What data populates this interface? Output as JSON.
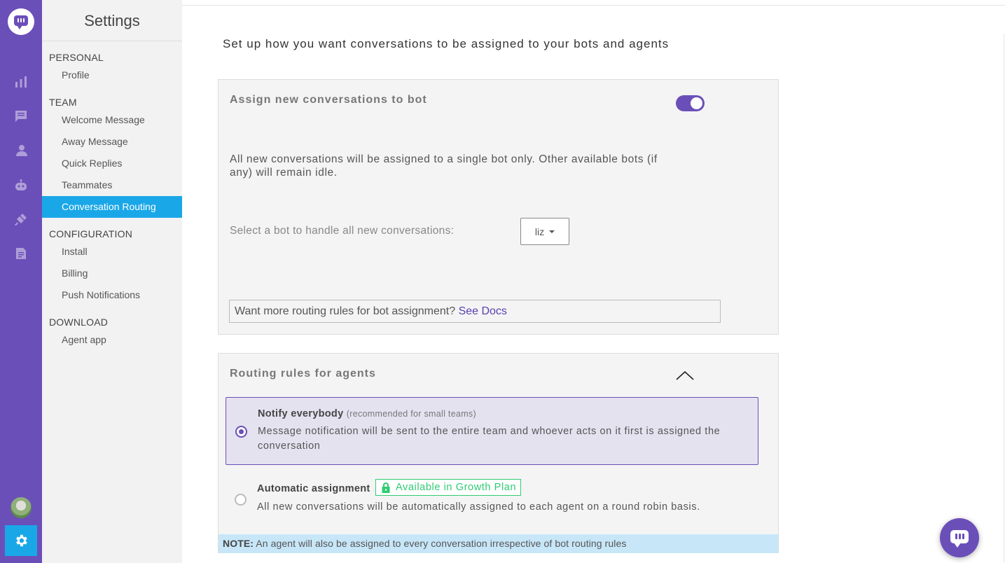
{
  "app": {
    "accent": "#6b4fb8",
    "highlight": "#1aa7e8"
  },
  "rail": {
    "icons": [
      "logo-icon",
      "analytics-icon",
      "conversations-icon",
      "users-icon",
      "bot-icon",
      "integrations-icon",
      "reports-icon",
      "avatar",
      "settings-gear-icon"
    ]
  },
  "sidebar": {
    "title": "Settings",
    "sections": [
      {
        "label": "PERSONAL",
        "items": [
          "Profile"
        ]
      },
      {
        "label": "TEAM",
        "items": [
          "Welcome Message",
          "Away Message",
          "Quick Replies",
          "Teammates",
          "Conversation Routing"
        ]
      },
      {
        "label": "CONFIGURATION",
        "items": [
          "Install",
          "Billing",
          "Push Notifications"
        ]
      },
      {
        "label": "DOWNLOAD",
        "items": [
          "Agent app"
        ]
      }
    ],
    "active_item": "Conversation Routing"
  },
  "main": {
    "heading": "Set up how you want conversations to be assigned to your bots and agents",
    "bot_card": {
      "title": "Assign new conversations to bot",
      "toggle_on": true,
      "description": "All new conversations will be assigned to a single bot only. Other available bots (if any) will remain idle.",
      "select_label": "Select a bot to handle all new conversations:",
      "selected_bot": "liz",
      "docs_text": "Want more routing rules for bot assignment?",
      "docs_link": "See Docs"
    },
    "agent_card": {
      "title": "Routing rules for agents",
      "options": [
        {
          "title": "Notify everybody",
          "subtitle": "(recommended for small teams)",
          "description": "Message notification will be sent to the entire team and whoever acts on it first is assigned the conversation",
          "selected": true
        },
        {
          "title": "Automatic assignment",
          "badge": "Available in Growth Plan",
          "description": "All new conversations will be automatically assigned to each agent on a round robin basis.",
          "selected": false
        }
      ],
      "note_label": "NOTE:",
      "note_text": "An agent will also be assigned to every conversation irrespective of bot routing rules"
    }
  }
}
